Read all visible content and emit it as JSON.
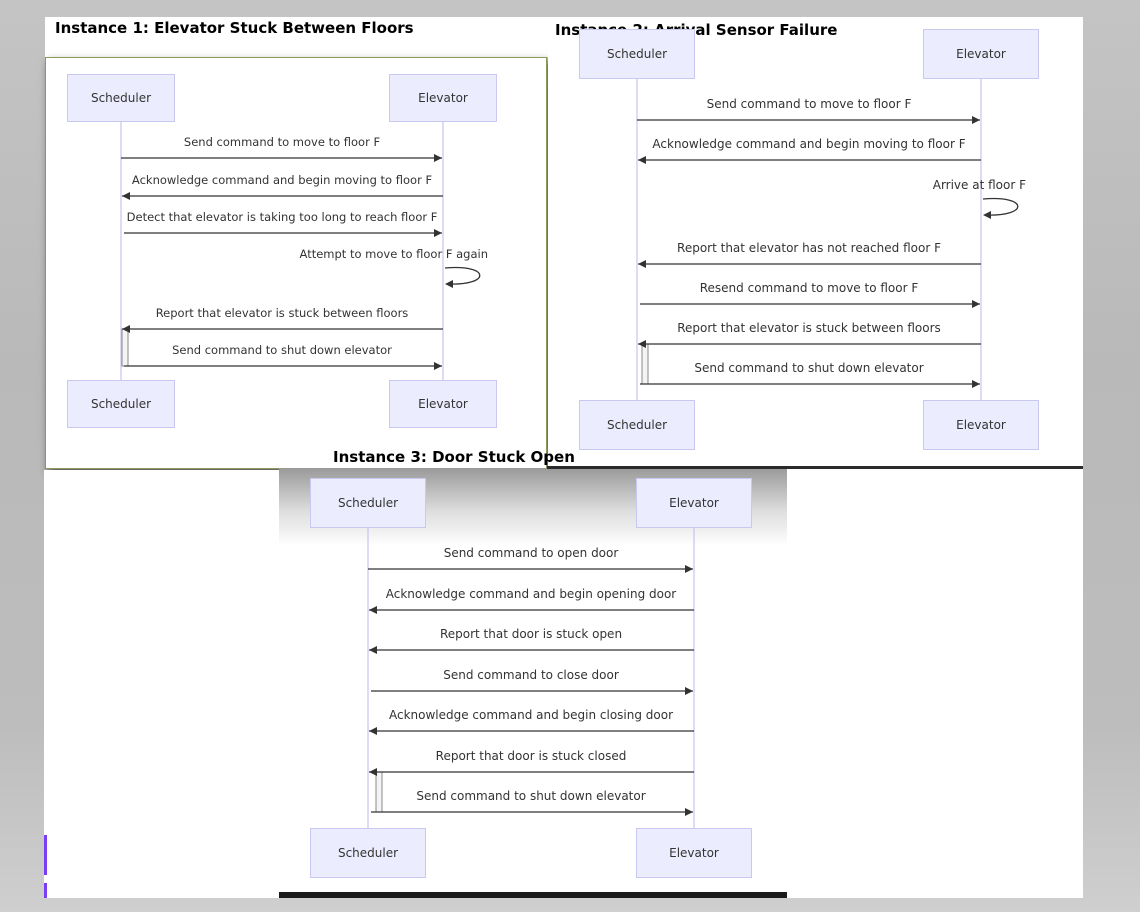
{
  "diagrams": [
    {
      "id": "instance-1",
      "title": "Instance 1: Elevator Stuck Between Floors",
      "actors": [
        "Scheduler",
        "Elevator"
      ],
      "messages": [
        {
          "from": "Scheduler",
          "to": "Elevator",
          "text": "Send command to move to floor F"
        },
        {
          "from": "Elevator",
          "to": "Scheduler",
          "text": "Acknowledge command and begin moving to floor F"
        },
        {
          "from": "Scheduler",
          "to": "Elevator",
          "text": "Detect that elevator is taking too long to reach floor F"
        },
        {
          "from": "Elevator",
          "to": "Elevator",
          "text": "Attempt to move to floor F again"
        },
        {
          "from": "Elevator",
          "to": "Scheduler",
          "text": "Report that elevator is stuck between floors"
        },
        {
          "from": "Scheduler",
          "to": "Elevator",
          "text": "Send command to shut down elevator"
        }
      ]
    },
    {
      "id": "instance-2",
      "title": "Instance 2: Arrival Sensor Failure",
      "actors": [
        "Scheduler",
        "Elevator"
      ],
      "messages": [
        {
          "from": "Scheduler",
          "to": "Elevator",
          "text": "Send command to move to floor F"
        },
        {
          "from": "Elevator",
          "to": "Scheduler",
          "text": "Acknowledge command and begin moving to floor F"
        },
        {
          "from": "Elevator",
          "to": "Elevator",
          "text": "Arrive at floor F"
        },
        {
          "from": "Elevator",
          "to": "Scheduler",
          "text": "Report that elevator has not reached floor F"
        },
        {
          "from": "Scheduler",
          "to": "Elevator",
          "text": "Resend command to move to floor F"
        },
        {
          "from": "Elevator",
          "to": "Scheduler",
          "text": "Report that elevator is stuck between floors"
        },
        {
          "from": "Scheduler",
          "to": "Elevator",
          "text": "Send command to shut down elevator"
        }
      ]
    },
    {
      "id": "instance-3",
      "title": "Instance 3: Door Stuck Open",
      "actors": [
        "Scheduler",
        "Elevator"
      ],
      "messages": [
        {
          "from": "Scheduler",
          "to": "Elevator",
          "text": "Send command to open door"
        },
        {
          "from": "Elevator",
          "to": "Scheduler",
          "text": "Acknowledge command and begin opening door"
        },
        {
          "from": "Elevator",
          "to": "Scheduler",
          "text": "Report that door is stuck open"
        },
        {
          "from": "Scheduler",
          "to": "Elevator",
          "text": "Send command to close door"
        },
        {
          "from": "Elevator",
          "to": "Scheduler",
          "text": "Acknowledge command and begin closing door"
        },
        {
          "from": "Elevator",
          "to": "Scheduler",
          "text": "Report that door is stuck closed"
        },
        {
          "from": "Scheduler",
          "to": "Elevator",
          "text": "Send command to shut down elevator"
        }
      ]
    }
  ],
  "colors": {
    "actor_fill": "#ececff",
    "actor_border": "#c8c8f0",
    "lifeline": "#c9c3f0",
    "arrow": "#333333",
    "accent": "#7a3ff2"
  }
}
